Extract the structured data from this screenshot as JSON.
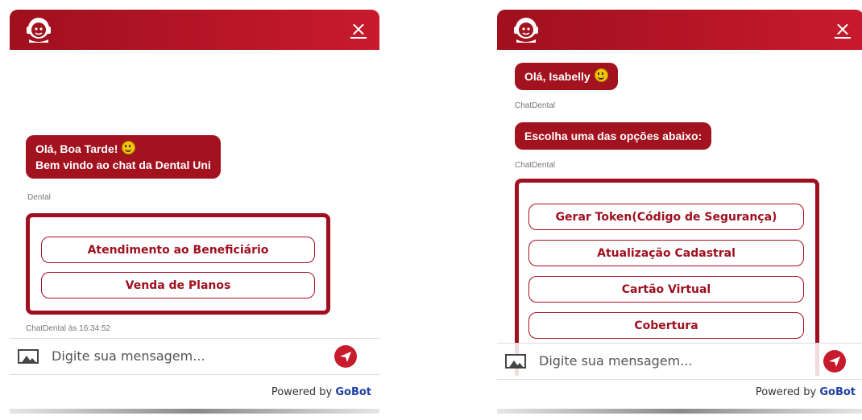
{
  "left": {
    "close_icon": "×",
    "welcome_line1": "Olá, Boa Tarde!",
    "welcome_line2": "Bem vindo ao chat da Dental Uni",
    "sender": "Dental",
    "options": [
      "Atendimento ao Beneficiário",
      "Venda de Planos"
    ],
    "timestamp": "ChatDental às 16:34:52",
    "input_placeholder": "Digite sua mensagem...",
    "powered_by": "Powered by",
    "brand": "GoBot"
  },
  "right": {
    "close_icon": "×",
    "greeting": "Olá, Isabelly",
    "sender1": "ChatDental",
    "prompt": "Escolha uma das opções abaixo:",
    "sender2": "ChatDental",
    "options": [
      "Gerar Token(Código de Segurança)",
      "Atualização Cadastral",
      "Cartão Virtual",
      "Cobertura"
    ],
    "input_placeholder": "Digite sua mensagem...",
    "powered_by": "Powered by",
    "brand": "GoBot"
  },
  "colors": {
    "brand_red": "#a3121f",
    "gobot_blue": "#1e3fa6"
  },
  "icons": [
    "agent-avatar-icon",
    "close-icon",
    "emoji-smile-icon",
    "image-attach-icon",
    "send-icon"
  ]
}
